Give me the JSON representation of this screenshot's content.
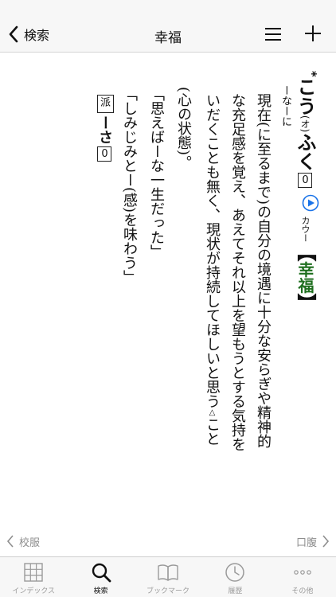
{
  "header": {
    "back_label": "検索",
    "title": "幸福"
  },
  "entry": {
    "asterisk": "*",
    "headword_pre": "こう",
    "headword_okurigana": "(オ)",
    "headword_post": "ふく",
    "accent": "0",
    "kana_reading": "カウー",
    "kanji_open": "【",
    "kanji": "幸福",
    "kanji_close": "】",
    "grammar": "ーなーに",
    "definition_lines": [
      "現在(に至るまで)の自分の境遇に十分な安らぎや精神的",
      "な充足感を覚え、あえてそれ以上を望もうとする気持を",
      "いだくことも無く、現状が持続してほしいと思う"
    ],
    "definition_triangle": "△",
    "definition_tail": "こと",
    "shin_note": "(心の状態)。",
    "examples": [
      "「思えばーな一生だった」",
      "「しみじみとー(感)を味わう」"
    ],
    "derivative_label": "派",
    "derivative_word": "ーさ",
    "derivative_accent": "0"
  },
  "navigation": {
    "prev_label": "校服",
    "next_label": "口腹"
  },
  "tabbar": {
    "items": [
      {
        "label": "インデックス",
        "icon": "grid-icon",
        "active": false
      },
      {
        "label": "検索",
        "icon": "search-icon",
        "active": true
      },
      {
        "label": "ブックマーク",
        "icon": "book-icon",
        "active": false
      },
      {
        "label": "履歴",
        "icon": "clock-icon",
        "active": false
      },
      {
        "label": "その他",
        "icon": "more-icon",
        "active": false
      }
    ]
  },
  "colors": {
    "kanji_green": "#1f6f1f",
    "play_blue": "#1a73e8",
    "active_tab": "#111111",
    "inactive_tab": "#9a9a9a"
  }
}
